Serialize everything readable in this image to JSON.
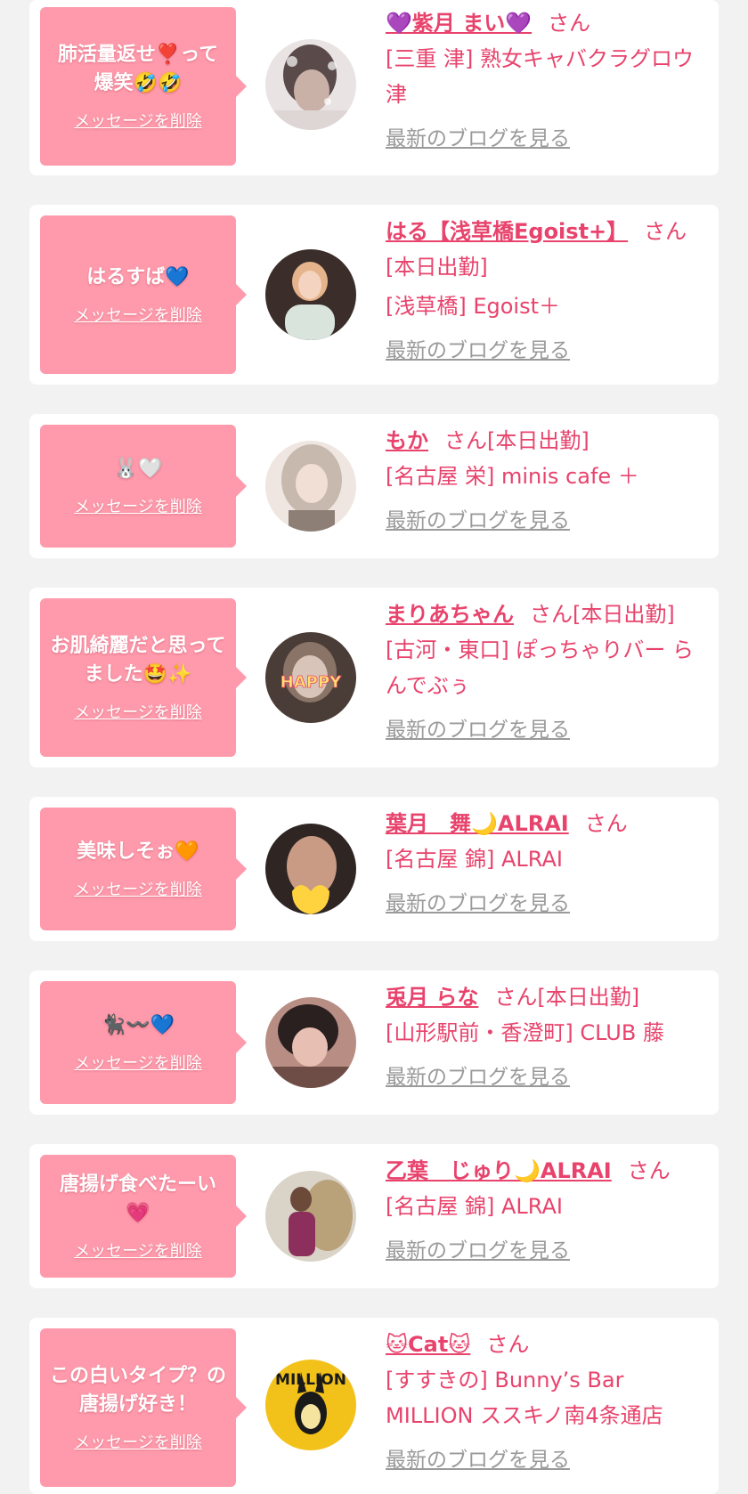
{
  "cards": [
    {
      "message": "肺活量返せ❣️って爆笑🤣🤣",
      "delete_label": "メッセージを削除",
      "name": "💜紫月 まい💜",
      "suffix": "さん",
      "shop": "[三重 津] 熟女キャバクラグロウ津",
      "blog_label": "最新のブログを見る",
      "avatar_colors": [
        "#e9e3e4",
        "#5a4a4a",
        "#c9b1a7"
      ]
    },
    {
      "message": "はるすば💙",
      "delete_label": "メッセージを削除",
      "name": "はる【浅草橋Egoist+】",
      "suffix": "さん",
      "status": "[本日出勤]",
      "shop": "[浅草橋] Egoist＋",
      "blog_label": "最新のブログを見る",
      "avatar_colors": [
        "#3b2e2a",
        "#e6b48c",
        "#f4d3c0"
      ]
    },
    {
      "message": "🐰🤍",
      "delete_label": "メッセージを削除",
      "name": "もか",
      "suffix": "さん[本日出勤]",
      "shop": "[名古屋 栄] minis cafe ＋",
      "blog_label": "最新のブログを見る",
      "avatar_colors": [
        "#c7b9ae",
        "#8d7f76",
        "#efe6e1"
      ]
    },
    {
      "message": "お肌綺麗だと思ってました🤩✨",
      "delete_label": "メッセージを削除",
      "name": "まりあちゃん",
      "suffix": "さん[本日出勤]",
      "shop": "[古河・東口] ぽっちゃりバー らんでぶぅ",
      "blog_label": "最新のブログを見る",
      "avatar_sticker": "HAPPY",
      "avatar_colors": [
        "#4a3c36",
        "#8a7467",
        "#d8c4b8"
      ]
    },
    {
      "message": "美味しそぉ🧡",
      "delete_label": "メッセージを削除",
      "name": "葉月　舞🌙ALRAI",
      "suffix": "さん",
      "shop": "[名古屋 錦] ALRAI",
      "blog_label": "最新のブログを見る",
      "avatar_colors": [
        "#2f2624",
        "#c99a84",
        "#ffd23f"
      ]
    },
    {
      "message": "🐈‍⬛〰️💙",
      "delete_label": "メッセージを削除",
      "name": "兎月 らな",
      "suffix": "さん[本日出勤]",
      "shop": "[山形駅前・香澄町] CLUB 藤",
      "blog_label": "最新のブログを見る",
      "avatar_colors": [
        "#2a2020",
        "#e8c0b3",
        "#b88e84"
      ]
    },
    {
      "message": "唐揚げ食べたーい💗",
      "delete_label": "メッセージを削除",
      "name": "乙葉　じゅり🌙ALRAI",
      "suffix": "さん",
      "shop": "[名古屋 錦] ALRAI",
      "blog_label": "最新のブログを見る",
      "avatar_colors": [
        "#d9d3c8",
        "#8c2f5c",
        "#b9a27a"
      ]
    },
    {
      "message": "この白いタイプ？の唐揚げ好き！",
      "delete_label": "メッセージを削除",
      "name": "🐱Cat🐱",
      "suffix": "さん",
      "shop": "[すすきの] Bunny’s Bar MILLION ススキノ南4条通店",
      "blog_label": "最新のブログを見る",
      "avatar_sticker": "MILLION",
      "avatar_colors": [
        "#f2c21b",
        "#1a1a1a",
        "#f5e4a0"
      ]
    }
  ],
  "colors": {
    "page_bg": "#f2f2f2",
    "bubble": "#fe9aab",
    "accent": "#e8436c",
    "blog_link": "#9a9a9a"
  }
}
